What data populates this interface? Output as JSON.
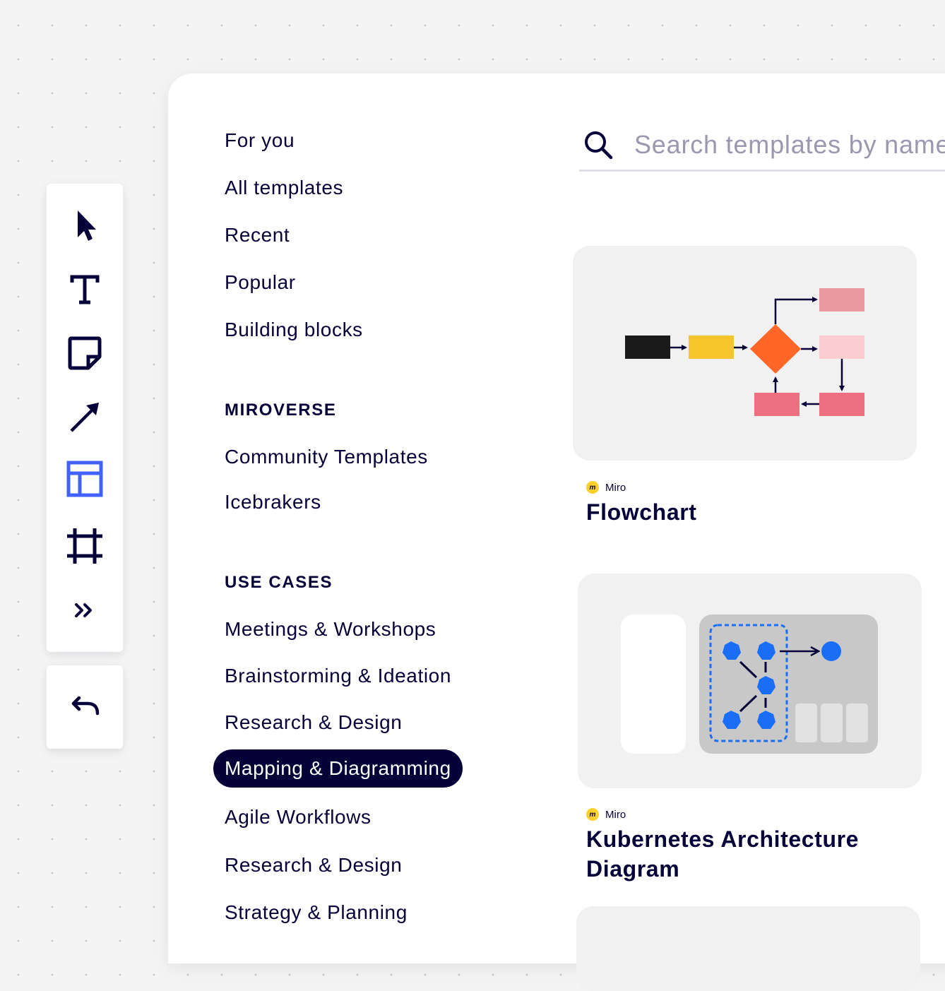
{
  "toolbar": {
    "tools": [
      {
        "name": "select-tool",
        "icon": "cursor-icon"
      },
      {
        "name": "text-tool",
        "icon": "text-icon"
      },
      {
        "name": "sticky-note-tool",
        "icon": "sticky-note-icon"
      },
      {
        "name": "arrow-tool",
        "icon": "arrow-icon"
      },
      {
        "name": "templates-tool",
        "icon": "templates-icon",
        "active": true
      },
      {
        "name": "frame-tool",
        "icon": "frame-icon"
      },
      {
        "name": "more-tools",
        "icon": "chevron-double-right-icon"
      }
    ],
    "undo_icon": "undo-icon",
    "accent_color": "#4262ff"
  },
  "nav": {
    "primary": [
      "For you",
      "All templates",
      "Recent",
      "Popular",
      "Building blocks"
    ],
    "miroverse_heading": "MIROVERSE",
    "miroverse": [
      "Community Templates",
      "Icebrakers"
    ],
    "use_cases_heading": "USE CASES",
    "use_cases": [
      "Meetings & Workshops",
      "Brainstorming & Ideation",
      "Research & Design",
      "Mapping & Diagramming",
      "Agile Workflows",
      "Research & Design",
      "Strategy & Planning"
    ],
    "active_item": "Mapping & Diagramming"
  },
  "search": {
    "placeholder": "Search templates by name",
    "icon": "search-icon"
  },
  "cards": [
    {
      "author": "Miro",
      "title": "Flowchart"
    },
    {
      "author": "Miro",
      "title_line1": "Kubernetes Architecture",
      "title_line2": "Diagram"
    }
  ],
  "colors": {
    "navy": "#050038",
    "flow_black": "#1a1a1a",
    "flow_yellow": "#f5c52b",
    "flow_orange": "#ff6628",
    "flow_pink": "#ec9aa0",
    "flow_light_pink": "#fbcdd0",
    "flow_red": "#ee6f80",
    "k8s_blue": "#1a6ef5"
  }
}
